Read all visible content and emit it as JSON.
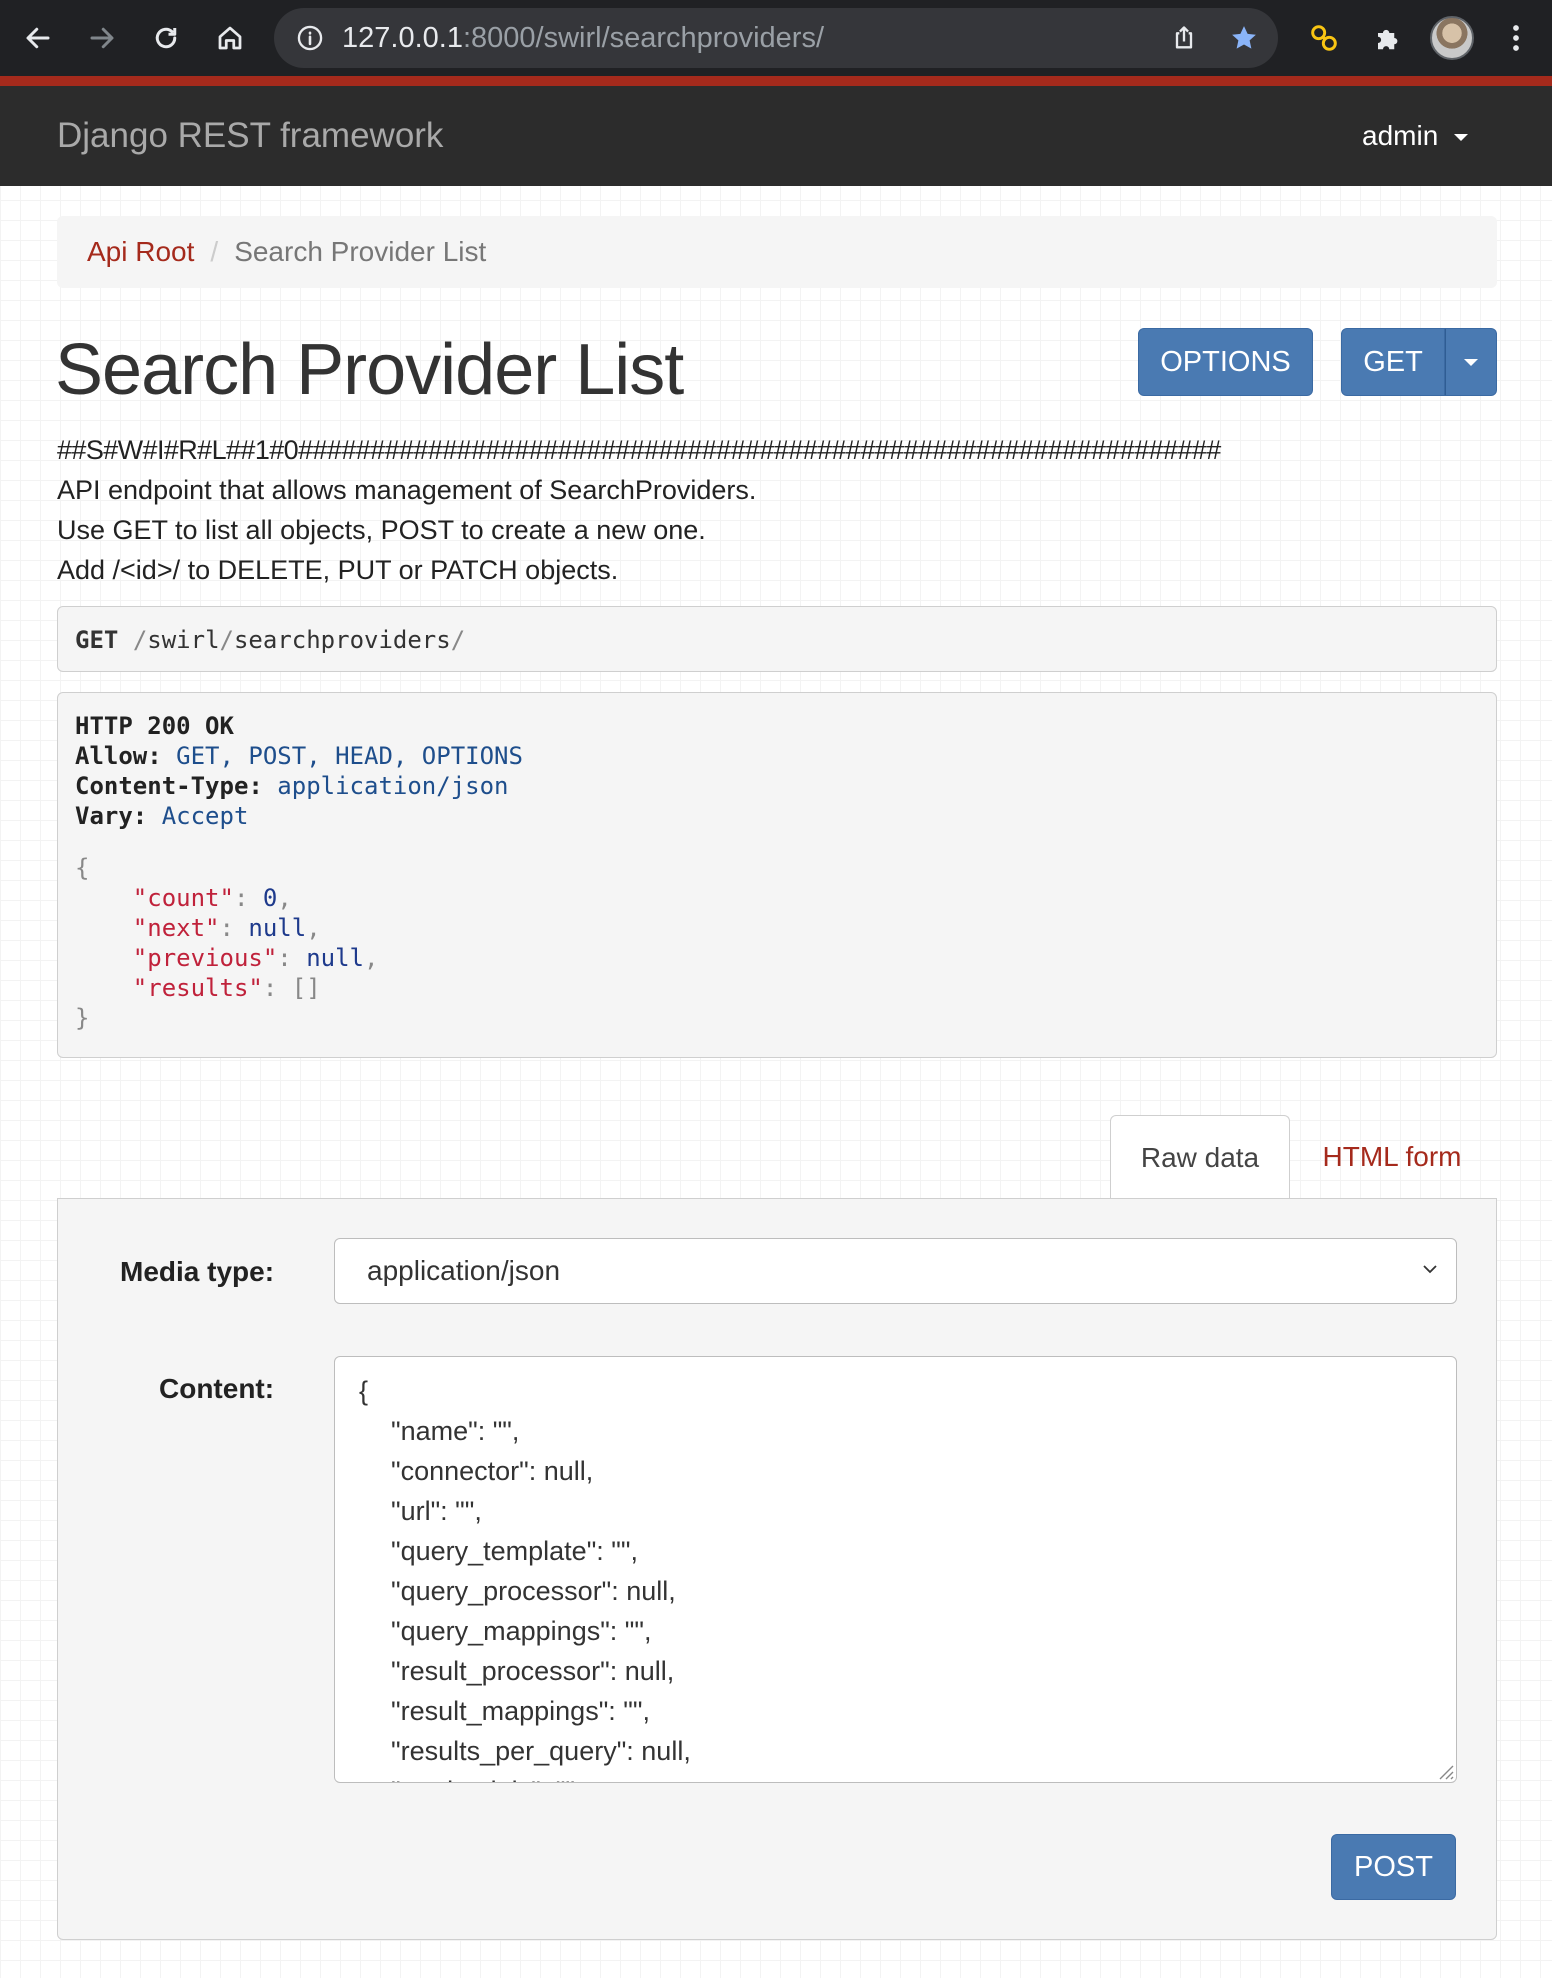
{
  "browser": {
    "url_host": "127.0.0.1",
    "url_rest": ":8000/swirl/searchproviders/",
    "icons": [
      "back-icon",
      "forward-icon",
      "reload-icon",
      "home-icon",
      "info-icon",
      "share-icon",
      "star-icon",
      "extension-link-icon",
      "puzzle-icon",
      "profile-avatar",
      "kebab-menu-icon"
    ]
  },
  "navbar": {
    "brand": "Django REST framework",
    "user": "admin"
  },
  "breadcrumb": {
    "root": "Api Root",
    "separator": "/",
    "current": "Search Provider List"
  },
  "header": {
    "title": "Search Provider List",
    "options_label": "OPTIONS",
    "get_label": "GET"
  },
  "description": {
    "line1": "##S#W#I#R#L##1#0################################################################",
    "line2": "API endpoint that allows management of SearchProviders.",
    "line3": "Use GET to list all objects, POST to create a new one.",
    "line4": "Add /<id>/ to DELETE, PUT or PATCH objects."
  },
  "request": {
    "method": "GET",
    "path_slash1": "/",
    "path_seg1": "swirl",
    "path_slash2": "/",
    "path_seg2": "searchproviders",
    "path_slash3": "/"
  },
  "response": {
    "status": "HTTP 200 OK",
    "allow_key": "Allow:",
    "allow_value": "GET, POST, HEAD, OPTIONS",
    "content_type_key": "Content-Type:",
    "content_type_value": "application/json",
    "vary_key": "Vary:",
    "vary_value": "Accept",
    "open_brace": "{",
    "close_brace": "}",
    "fields": [
      {
        "key": "\"count\"",
        "value": "0",
        "trail": ","
      },
      {
        "key": "\"next\"",
        "value": "null",
        "trail": ","
      },
      {
        "key": "\"previous\"",
        "value": "null",
        "trail": ","
      },
      {
        "key": "\"results\"",
        "value": "[]",
        "trail": ""
      }
    ]
  },
  "tabs": {
    "raw": "Raw data",
    "html": "HTML form"
  },
  "form": {
    "media_label": "Media type:",
    "media_value": "application/json",
    "content_label": "Content:",
    "content_lines": [
      "{",
      "\"name\": \"\",",
      "\"connector\": null,",
      "\"url\": \"\",",
      "\"query_template\": \"\",",
      "\"query_processor\": null,",
      "\"query_mappings\": \"\",",
      "\"result_processor\": null,",
      "\"result_mappings\": \"\",",
      "\"results_per_query\": null,",
      "\"credentials\": \"\","
    ],
    "post_label": "POST"
  },
  "colors": {
    "brand_red": "#a52a1c",
    "button_blue": "#4a7ab2",
    "navbar_bg": "#2c2c2c"
  }
}
